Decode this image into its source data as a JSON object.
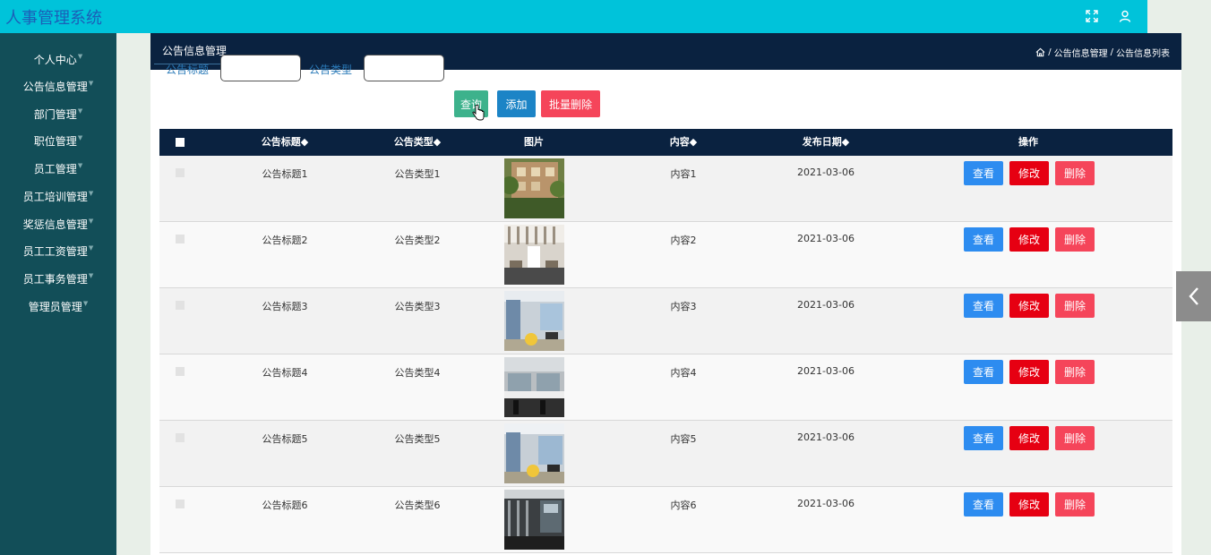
{
  "app": {
    "title": "人事管理系统"
  },
  "sidebar": {
    "items": [
      {
        "label": "个人中心"
      },
      {
        "label": "公告信息管理"
      },
      {
        "label": "部门管理"
      },
      {
        "label": "职位管理"
      },
      {
        "label": "员工管理"
      },
      {
        "label": "员工培训管理"
      },
      {
        "label": "奖惩信息管理"
      },
      {
        "label": "员工工资管理"
      },
      {
        "label": "员工事务管理"
      },
      {
        "label": "管理员管理"
      }
    ]
  },
  "header": {
    "tab": "公告信息管理",
    "breadcrumb": [
      "公告信息管理",
      "公告信息列表"
    ]
  },
  "filters": {
    "title_label": "公告标题",
    "title_value": "",
    "type_label": "公告类型",
    "type_value": "",
    "search_label": "查询",
    "add_label": "添加",
    "batch_delete_label": "批量删除"
  },
  "table": {
    "columns": [
      "公告标题◆",
      "公告类型◆",
      "图片",
      "内容◆",
      "发布日期◆",
      "操作"
    ],
    "rows": [
      {
        "title": "公告标题1",
        "type": "公告类型1",
        "content": "内容1",
        "date": "2021-03-06"
      },
      {
        "title": "公告标题2",
        "type": "公告类型2",
        "content": "内容2",
        "date": "2021-03-06"
      },
      {
        "title": "公告标题3",
        "type": "公告类型3",
        "content": "内容3",
        "date": "2021-03-06"
      },
      {
        "title": "公告标题4",
        "type": "公告类型4",
        "content": "内容4",
        "date": "2021-03-06"
      },
      {
        "title": "公告标题5",
        "type": "公告类型5",
        "content": "内容5",
        "date": "2021-03-06"
      },
      {
        "title": "公告标题6",
        "type": "公告类型6",
        "content": "内容6",
        "date": "2021-03-06"
      }
    ],
    "actions": {
      "view": "查看",
      "edit": "修改",
      "delete": "删除"
    }
  },
  "colors": {
    "topbar": "#00c3da",
    "sidebar": "#124e58",
    "header": "#0a2240",
    "view": "#2d8cf0",
    "edit": "#e60012",
    "delete": "#f5455a",
    "search": "#3db28c",
    "add": "#1c84c6",
    "batch_delete": "#f5455a"
  },
  "icons": {
    "fullscreen": "fullscreen-icon",
    "user": "user-icon",
    "home": "home-icon",
    "collapse": "chevron-left-icon"
  }
}
